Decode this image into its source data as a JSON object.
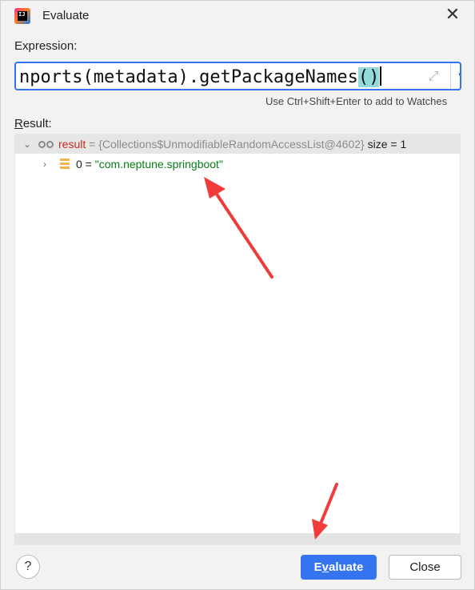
{
  "window": {
    "title": "Evaluate",
    "close_glyph": "✕",
    "app_icon_label": "IJ"
  },
  "expression": {
    "label": "Expression:",
    "value_main": "nports(metadata).getPackageNames",
    "value_paren": "()",
    "expand_glyph": "⤢",
    "dropdown_glyph": "▼",
    "hint": "Use Ctrl+Shift+Enter to add to Watches"
  },
  "result": {
    "label_mnemonic": "R",
    "label_rest": "esult:",
    "rows": [
      {
        "toggle": "⌄",
        "icon": "watch-icon",
        "name": "result",
        "eq": " = ",
        "type": "{Collections$UnmodifiableRandomAccessList@4602}",
        "extra": "size = 1"
      },
      {
        "toggle": "›",
        "icon": "list-item-icon",
        "index": "0",
        "eq": " = ",
        "value": "\"com.neptune.springboot\""
      }
    ]
  },
  "footer": {
    "help_glyph": "?",
    "evaluate_mnemonic": "v",
    "evaluate_pre": "E",
    "evaluate_post": "aluate",
    "close_label": "Close"
  },
  "colors": {
    "accent": "#3574f0",
    "annotation_arrow": "#f23b3b",
    "string_value": "#067d17",
    "variable_name": "#c42b1c"
  }
}
